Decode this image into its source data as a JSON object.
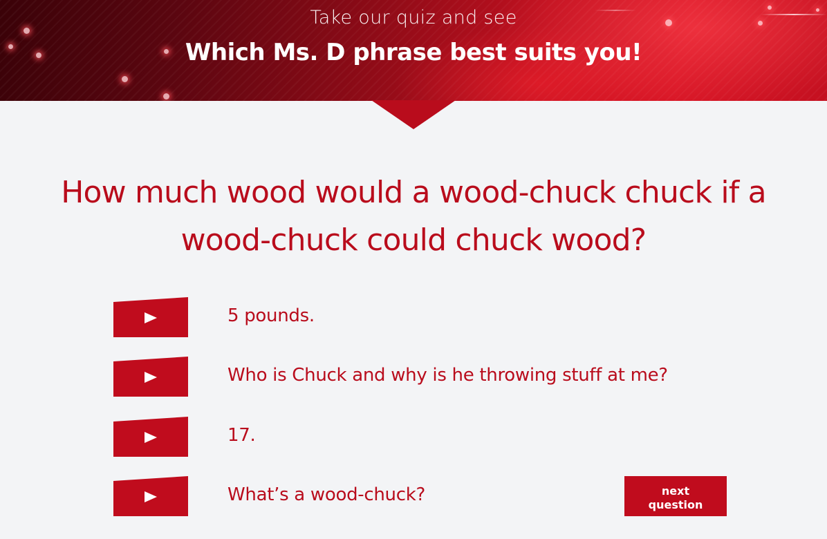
{
  "header": {
    "subtitle": "Take our quiz and see",
    "title": "Which Ms. D phrase best suits you!"
  },
  "question": {
    "text": "How much wood would a wood-chuck chuck if a wood-chuck could chuck wood?"
  },
  "answers": [
    {
      "label": "5 pounds.",
      "icon": "play-icon"
    },
    {
      "label": "Who is Chuck and why is he throwing stuff at me?",
      "icon": "play-icon"
    },
    {
      "label": "17.",
      "icon": "play-icon"
    },
    {
      "label": "What’s a wood-chuck?",
      "icon": "play-icon"
    }
  ],
  "next_button": {
    "line1": "next",
    "line2": "question"
  },
  "colors": {
    "accent": "#c00c1d",
    "text_red": "#b90c1c",
    "background": "#f3f4f6"
  }
}
